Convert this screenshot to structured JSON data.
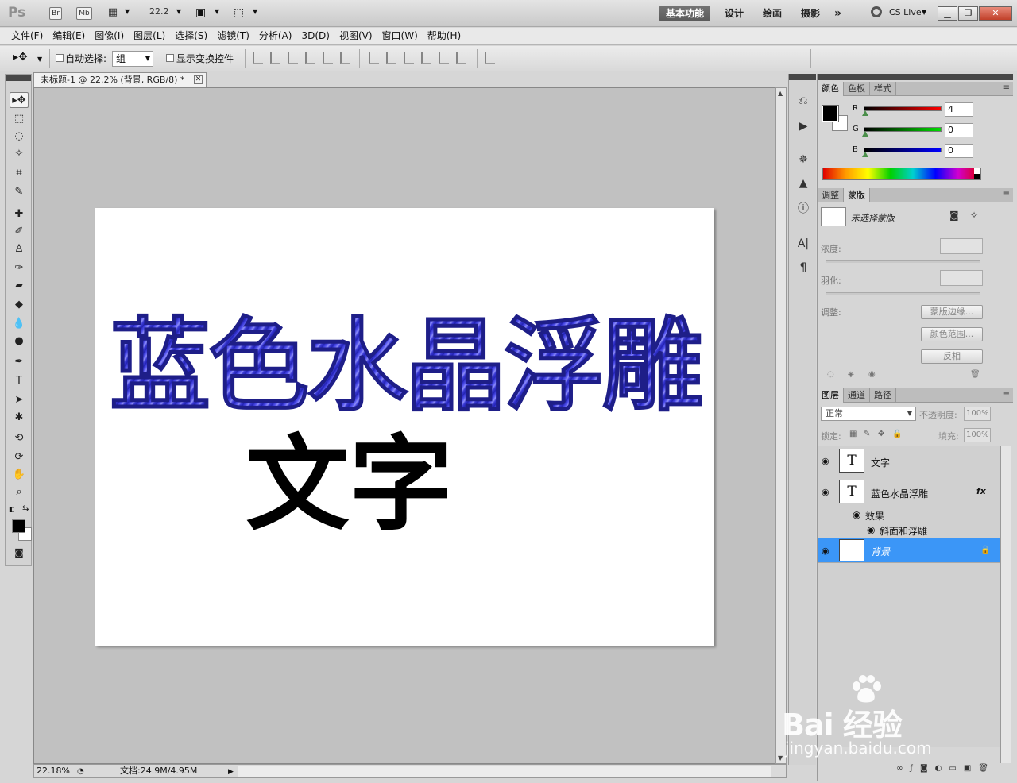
{
  "appbar": {
    "logo": "Ps",
    "bridge_label": "Br",
    "minibridge_label": "Mb",
    "zoom_value": "22.2",
    "workspaces": [
      "基本功能",
      "设计",
      "绘画",
      "摄影"
    ],
    "more_label": "»",
    "cslive_label": "CS Live"
  },
  "menu": [
    "文件(F)",
    "编辑(E)",
    "图像(I)",
    "图层(L)",
    "选择(S)",
    "滤镜(T)",
    "分析(A)",
    "3D(D)",
    "视图(V)",
    "窗口(W)",
    "帮助(H)"
  ],
  "options": {
    "auto_select_label": "自动选择:",
    "auto_select_value": "组",
    "show_transform_label": "显示变换控件"
  },
  "document": {
    "tab_title": "未标题-1 @ 22.2% (背景, RGB/8) *",
    "blue_text": "蓝色水晶浮雕",
    "black_text": "文字"
  },
  "status": {
    "zoom": "22.18%",
    "doc_size": "文档:24.9M/4.95M"
  },
  "color_panel": {
    "tabs": [
      "颜色",
      "色板",
      "样式"
    ],
    "r_label": "R",
    "g_label": "G",
    "b_label": "B",
    "r_value": "4",
    "g_value": "0",
    "b_value": "0"
  },
  "mask_panel": {
    "tabs": [
      "调整",
      "蒙版"
    ],
    "no_selection": "未选择蒙版",
    "density_label": "浓度:",
    "feather_label": "羽化:",
    "refine_label": "调整:",
    "buttons": [
      "蒙版边缘...",
      "颜色范围...",
      "反相"
    ]
  },
  "layers_panel": {
    "tabs": [
      "图层",
      "通道",
      "路径"
    ],
    "blend_mode": "正常",
    "opacity_label": "不透明度:",
    "opacity_value": "100%",
    "lock_label": "锁定:",
    "fill_label": "填充:",
    "fill_value": "100%",
    "layers": [
      {
        "name": "文字",
        "thumb": "T"
      },
      {
        "name": "蓝色水晶浮雕",
        "thumb": "T",
        "fx": "fx"
      },
      {
        "name": "背景",
        "thumb": ""
      }
    ],
    "effects_label": "效果",
    "bevel_label": "斜面和浮雕"
  },
  "watermark": {
    "brand": "Bai  经验",
    "url": "jingyan.baidu.com"
  },
  "colors": {
    "selected_layer": "#3b96f7",
    "workspace_active": "#666666",
    "crystal_blue": "#3b3bd8"
  }
}
